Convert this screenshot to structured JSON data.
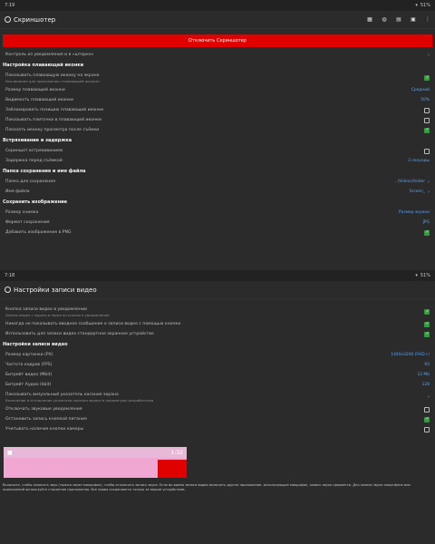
{
  "panel1": {
    "status_time": "7:19",
    "status_right": "51%",
    "app_title": "Скриншотер",
    "red_button": "Отключить Скриншотер",
    "control_notif": "Контроль из уведомления и в «шторке»",
    "sections": [
      {
        "title": "Настройка плавающей иконки",
        "rows": [
          {
            "label": "Показывать плавающую иконку на экране",
            "sub": "Исключение для приложения «плавающей иконки»",
            "type": "checkbox",
            "checked": true,
            "tall": true
          },
          {
            "label": "Размер плавающей иконки",
            "type": "value",
            "value": "Средний"
          },
          {
            "label": "Видимость плавающей иконки",
            "type": "value",
            "value": "50%"
          },
          {
            "label": "Заблокировать позицию плавающей иконки",
            "type": "checkbox",
            "checked": false
          },
          {
            "label": "Показывать плиточки в плавающей иконки",
            "type": "checkbox",
            "checked": false
          },
          {
            "label": "Показать иконку просмотра после съёмки",
            "type": "checkbox",
            "checked": true
          }
        ]
      },
      {
        "title": "Встряхивание и задержка",
        "rows": [
          {
            "label": "Скриншот встряхиванием",
            "type": "checkbox",
            "checked": false
          },
          {
            "label": "Задержка перед съёмкой",
            "type": "value",
            "value": "3 секунды"
          }
        ]
      },
      {
        "title": "Папка сохранения и имя файла",
        "rows": [
          {
            "label": "Папка для сохранения",
            "type": "value",
            "value": "...\\Videos\\folder",
            "chev": true
          },
          {
            "label": "Имя файла",
            "type": "value",
            "value": "Screen_",
            "chev": true
          }
        ]
      },
      {
        "title": "Сохранить изображение",
        "rows": [
          {
            "label": "Размер снимка",
            "type": "value",
            "value": "Размер экрана"
          },
          {
            "label": "Формат сохранения",
            "type": "value",
            "value": "JPG"
          },
          {
            "label": "Добавить изображение в PNG",
            "type": "checkbox",
            "checked": true
          }
        ]
      }
    ]
  },
  "panel2": {
    "status_time": "7:18",
    "status_right": "51%",
    "app_title": "Настройки записи видео",
    "rows_top": [
      {
        "label": "Кнопка записи видео в уведомлении",
        "sub": "Запись видео с экрана и звука по кнопке в уведомлении",
        "checked": true,
        "tall": true
      },
      {
        "label": "Никогда не показывать вводное сообщение о записи видео с помощью кнопки",
        "checked": true
      },
      {
        "label": "Использовать для записи видео стандартное экранное устройство",
        "checked": true
      }
    ],
    "section_video": "Настройки записи видео",
    "video_rows": [
      {
        "label": "Размер картинки (PX)",
        "value": "1440x3200 (FHD+)"
      },
      {
        "label": "Частота кадров (FPS)",
        "value": "60"
      },
      {
        "label": "Битрейт видео (Mbit)",
        "value": "12 Mb"
      },
      {
        "label": "Битрейт Аудио (kbit)",
        "value": "128"
      }
    ],
    "pointer_row": {
      "label": "Показывать визуальный указатель касания экрана",
      "sub": "Включение и отключение указателя касания экрана в параметрах разработчика",
      "chev": "›"
    },
    "rows_bottom": [
      {
        "label": "Отключать звуковые уведомления",
        "checked": false
      },
      {
        "label": "Остановить запись кнопкой питания",
        "checked": true
      },
      {
        "label": "Учитывать наличие кнопки камеры",
        "checked": false
      }
    ],
    "preview_time": "1:32",
    "footnote": "Включите, чтобы записать звук (только через микрофон), чтобы отключить запись звука. Если во время записи видео включить другое приложение, использующее микрофон, запись звука прервётся. Для записи звука смартфона или приложений используйте сторонние приложения. Все права сохраняются только за вашим устройством."
  },
  "colors": {
    "accent_red": "#e00000",
    "check_green": "#2e9d3a",
    "value_blue": "#5aa0e8"
  }
}
